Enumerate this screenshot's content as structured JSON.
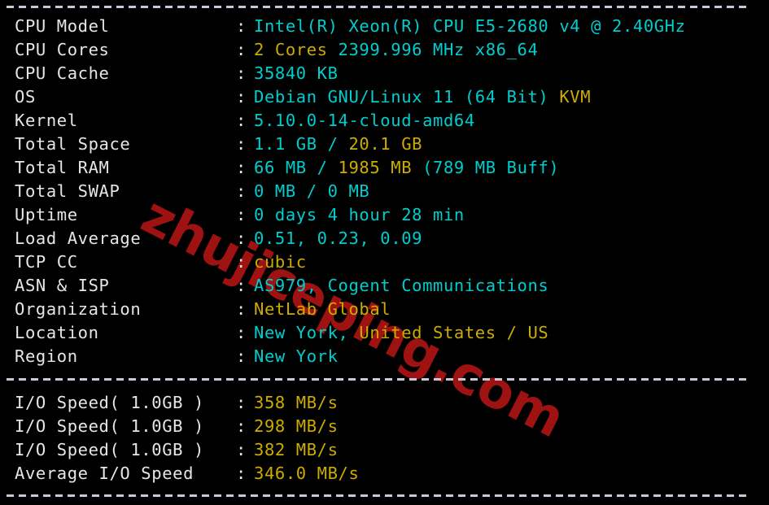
{
  "terminal": {
    "watermark_text": "zhujiceping.com",
    "separator_glyph": "-",
    "colon": ":",
    "colors": {
      "background": "#000000",
      "label": "#e6e6e6",
      "cyan": "#00cdcd",
      "yellow": "#cdac00",
      "watermark": "#9e1212"
    }
  },
  "system_info": {
    "rows": [
      {
        "label": "CPU Model",
        "segments": [
          {
            "text": "Intel(R) Xeon(R) CPU E5-2680 v4 @ 2.40GHz",
            "color": "cyan"
          }
        ]
      },
      {
        "label": "CPU Cores",
        "segments": [
          {
            "text": "2 Cores ",
            "color": "yellow"
          },
          {
            "text": "2399.996 MHz x86_64",
            "color": "cyan"
          }
        ]
      },
      {
        "label": "CPU Cache",
        "segments": [
          {
            "text": "35840 KB",
            "color": "cyan"
          }
        ]
      },
      {
        "label": "OS",
        "segments": [
          {
            "text": "Debian GNU/Linux 11 (64 Bit) ",
            "color": "cyan"
          },
          {
            "text": "KVM",
            "color": "yellow"
          }
        ]
      },
      {
        "label": "Kernel",
        "segments": [
          {
            "text": "5.10.0-14-cloud-amd64",
            "color": "cyan"
          }
        ]
      },
      {
        "label": "Total Space",
        "segments": [
          {
            "text": "1.1 GB / ",
            "color": "cyan"
          },
          {
            "text": "20.1 GB",
            "color": "yellow"
          }
        ]
      },
      {
        "label": "Total RAM",
        "segments": [
          {
            "text": "66 MB / ",
            "color": "cyan"
          },
          {
            "text": "1985 MB ",
            "color": "yellow"
          },
          {
            "text": "(789 MB Buff)",
            "color": "cyan"
          }
        ]
      },
      {
        "label": "Total SWAP",
        "segments": [
          {
            "text": "0 MB / 0 MB",
            "color": "cyan"
          }
        ]
      },
      {
        "label": "Uptime",
        "segments": [
          {
            "text": "0 days 4 hour 28 min",
            "color": "cyan"
          }
        ]
      },
      {
        "label": "Load Average",
        "segments": [
          {
            "text": "0.51, 0.23, 0.09",
            "color": "cyan"
          }
        ]
      },
      {
        "label": "TCP CC",
        "segments": [
          {
            "text": "cubic",
            "color": "yellow"
          }
        ]
      },
      {
        "label": "ASN & ISP",
        "segments": [
          {
            "text": "AS979, Cogent Communications",
            "color": "cyan"
          }
        ]
      },
      {
        "label": "Organization",
        "segments": [
          {
            "text": "NetLab Global",
            "color": "yellow"
          }
        ]
      },
      {
        "label": "Location",
        "segments": [
          {
            "text": "New York, ",
            "color": "cyan"
          },
          {
            "text": "United States / US",
            "color": "yellow"
          }
        ]
      },
      {
        "label": "Region",
        "segments": [
          {
            "text": "New York",
            "color": "cyan"
          }
        ]
      }
    ]
  },
  "io_benchmark": {
    "rows": [
      {
        "label": "I/O Speed( 1.0GB )",
        "segments": [
          {
            "text": "358 MB/s",
            "color": "yellow"
          }
        ]
      },
      {
        "label": "I/O Speed( 1.0GB )",
        "segments": [
          {
            "text": "298 MB/s",
            "color": "yellow"
          }
        ]
      },
      {
        "label": "I/O Speed( 1.0GB )",
        "segments": [
          {
            "text": "382 MB/s",
            "color": "yellow"
          }
        ]
      },
      {
        "label": "Average I/O Speed",
        "segments": [
          {
            "text": "346.0 MB/s",
            "color": "yellow"
          }
        ]
      }
    ]
  }
}
